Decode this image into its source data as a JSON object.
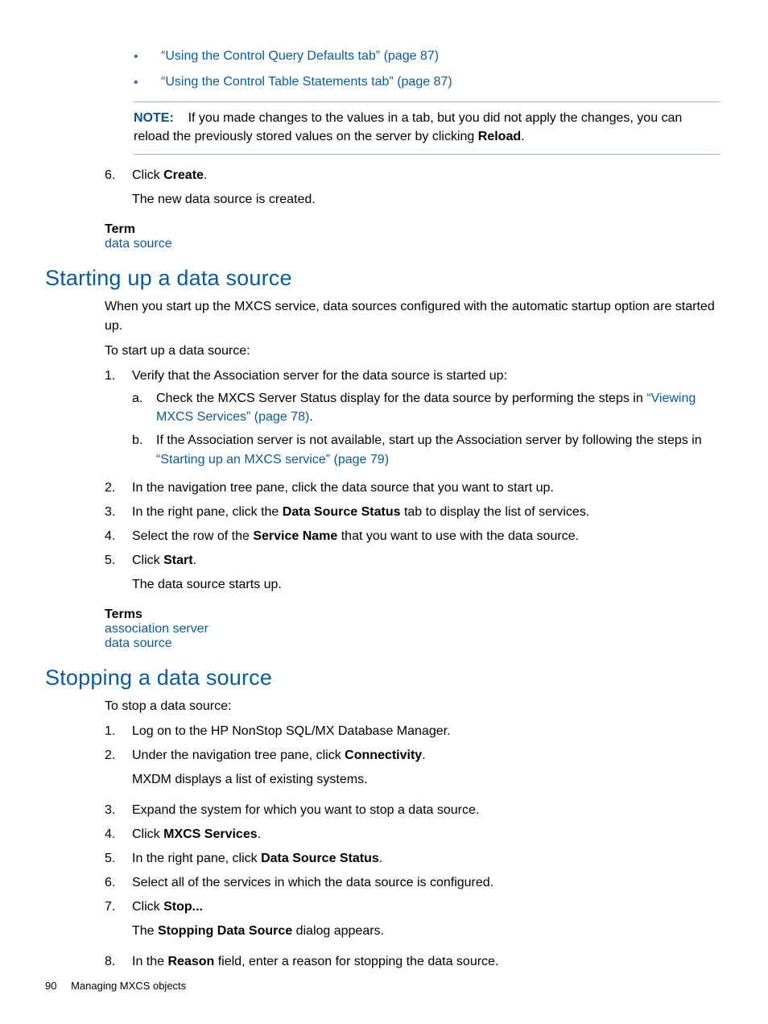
{
  "top": {
    "bullets": [
      "“Using the Control Query Defaults tab” (page 87)",
      "“Using the Control Table Statements tab” (page 87)"
    ],
    "note_label": "NOTE:",
    "note_text_1": "If you made changes to the values in a tab, but you did not apply the changes, you can reload the previously stored values on the server by clicking ",
    "note_bold": "Reload",
    "note_text_2": "."
  },
  "step6": {
    "num": "6.",
    "text_1": "Click ",
    "bold": "Create",
    "text_2": ".",
    "after": "The new data source is created."
  },
  "term1": {
    "title": "Term",
    "link": "data source"
  },
  "starting": {
    "heading": "Starting up a data source",
    "intro": "When you start up the MXCS service, data sources configured with the automatic startup option are started up.",
    "lead": "To start up a data source:",
    "items": [
      {
        "num": "1.",
        "text": "Verify that the Association server for the data source is started up:",
        "sub": [
          {
            "num": "a.",
            "pre": "Check the MXCS Server Status display for the data source by performing the steps in ",
            "link": "“Viewing MXCS Services” (page 78)",
            "post": "."
          },
          {
            "num": "b.",
            "pre": "If the Association server is not available, start up the Association server by following the steps in ",
            "link": "“Starting up an MXCS service” (page 79)",
            "post": ""
          }
        ]
      },
      {
        "num": "2.",
        "text": "In the navigation tree pane, click the data source that you want to start up."
      },
      {
        "num": "3.",
        "pre": "In the right pane, click the ",
        "bold": "Data Source Status",
        "post": " tab to display the list of services."
      },
      {
        "num": "4.",
        "pre": "Select the row of the ",
        "bold": "Service Name",
        "post": " that you want to use with the data source."
      },
      {
        "num": "5.",
        "pre": "Click ",
        "bold": "Start",
        "post": ".",
        "after": "The data source starts up."
      }
    ],
    "terms_title": "Terms",
    "terms": [
      "association server",
      "data source"
    ]
  },
  "stopping": {
    "heading": "Stopping a data source",
    "lead": "To stop a data source:",
    "items": [
      {
        "num": "1.",
        "text": "Log on to the HP NonStop SQL/MX Database Manager."
      },
      {
        "num": "2.",
        "pre": "Under the navigation tree pane, click ",
        "bold": "Connectivity",
        "post": ".",
        "after": "MXDM displays a list of existing systems."
      },
      {
        "num": "3.",
        "text": "Expand the system for which you want to stop a data source."
      },
      {
        "num": "4.",
        "pre": "Click ",
        "bold": "MXCS Services",
        "post": "."
      },
      {
        "num": "5.",
        "pre": "In the right pane, click ",
        "bold": "Data Source Status",
        "post": "."
      },
      {
        "num": "6.",
        "text": "Select all of the services in which the data source is configured."
      },
      {
        "num": "7.",
        "pre": "Click ",
        "bold": "Stop...",
        "post": "",
        "after_pre": "The ",
        "after_bold": "Stopping Data Source",
        "after_post": " dialog appears."
      },
      {
        "num": "8.",
        "pre": "In the ",
        "bold": "Reason",
        "post": " field, enter a reason for stopping the data source."
      }
    ]
  },
  "footer": {
    "page": "90",
    "chapter": "Managing MXCS objects"
  }
}
